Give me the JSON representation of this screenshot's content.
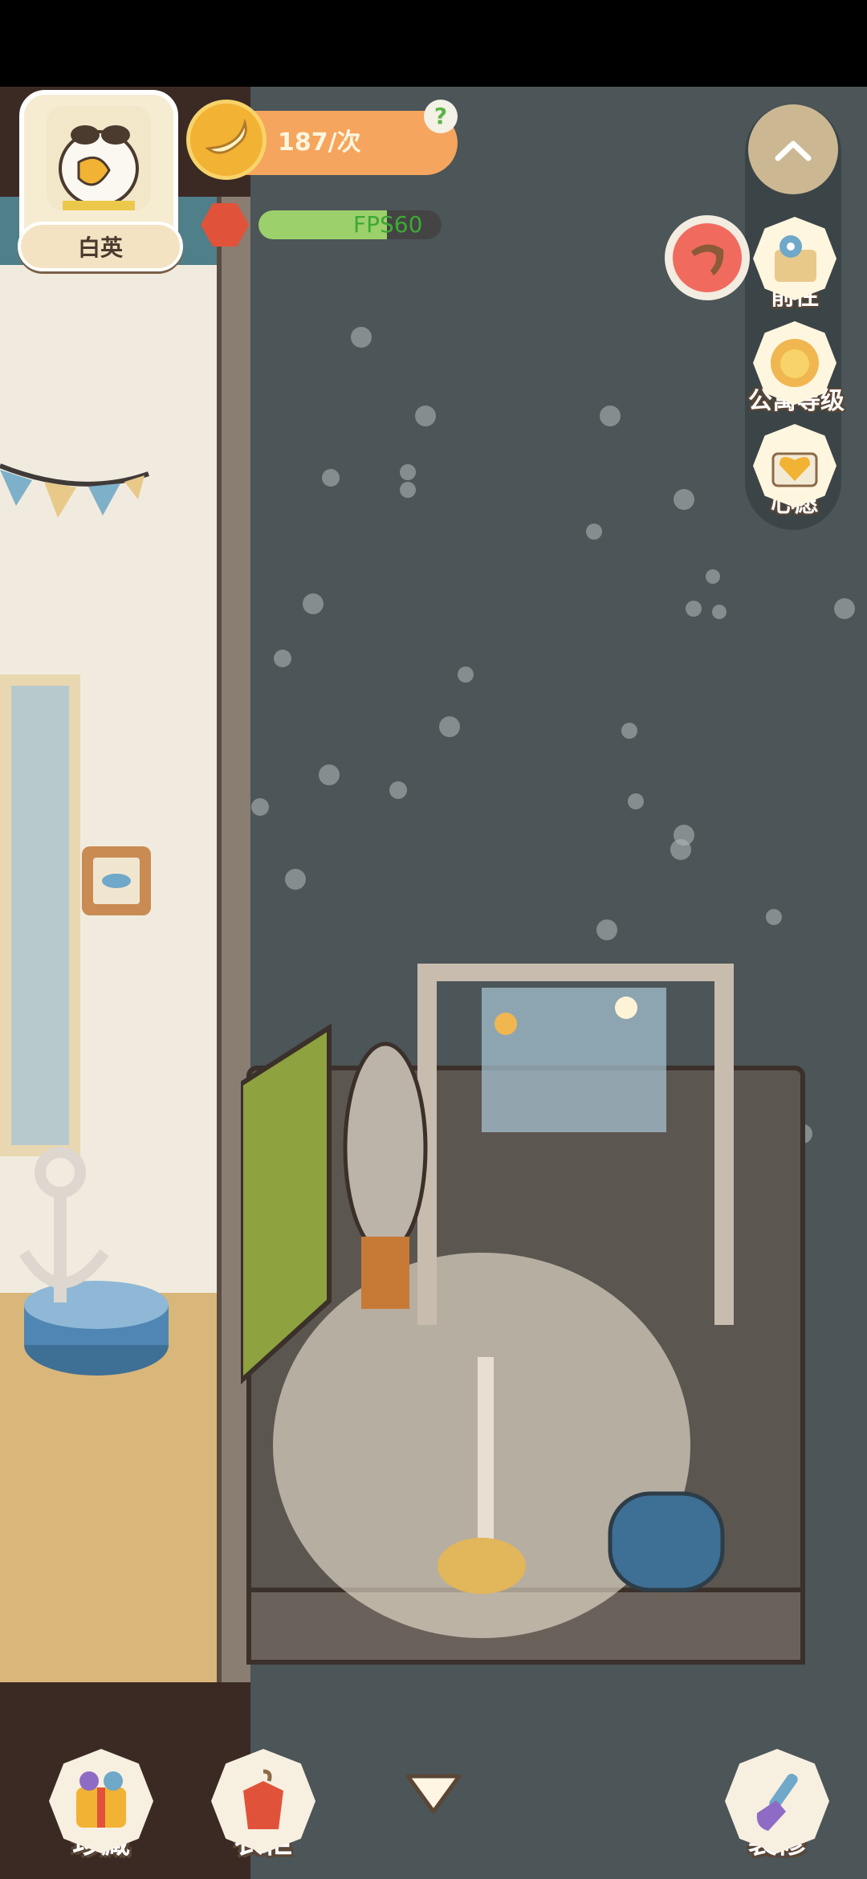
{
  "player": {
    "name": "白英"
  },
  "counter": {
    "value": "187/次",
    "help": "?"
  },
  "fps": {
    "label": "FPS60"
  },
  "side_menu": {
    "goto_label": "前往",
    "apartment_level_label": "公寓等级",
    "wish_label": "心愿"
  },
  "bottom_nav": {
    "collection_label": "珍藏",
    "wardrobe_label": "衣柜",
    "decorate_label": "装修"
  },
  "icons": {
    "banana": "banana-icon",
    "help": "question-icon",
    "fps_status": "bug-icon",
    "collapse": "chevron-up-icon",
    "boomerang": "boomerang-icon",
    "goto": "map-pin-icon",
    "apartment_level": "cat-sun-icon",
    "wish": "heart-book-icon",
    "collection": "gift-box-icon",
    "wardrobe": "shirt-hanger-icon",
    "decorate": "paint-brush-icon",
    "expand": "chevron-down-icon"
  },
  "colors": {
    "counter_bg": "#f5a55d",
    "fps_green": "#3ea836",
    "label_outline": "#5a4636"
  }
}
